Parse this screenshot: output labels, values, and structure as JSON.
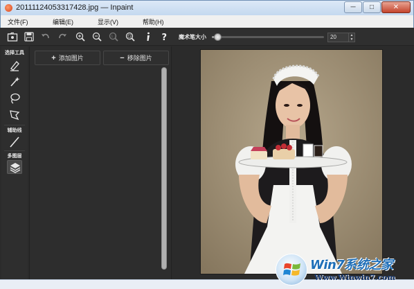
{
  "window": {
    "title": "20111124053317428.jpg — Inpaint",
    "buttons": {
      "minimize": "─",
      "maximize": "□",
      "close": "✕"
    }
  },
  "menu": [
    {
      "label": "文件(F)"
    },
    {
      "label": "编辑(E)"
    },
    {
      "label": "显示(V)"
    },
    {
      "label": "帮助(H)"
    }
  ],
  "toolbar": {
    "icons": [
      "open-icon",
      "save-icon",
      "undo-icon",
      "redo-icon",
      "zoom-in-icon",
      "zoom-out-icon",
      "actual-size-icon",
      "fit-window-icon",
      "info-icon",
      "help-icon"
    ],
    "brush_size_label": "魔术笔大小",
    "brush_size_value": "20",
    "brush_size_fraction": 0.05
  },
  "tools": {
    "select_label": "选择工具",
    "select_items": [
      "marker-icon",
      "magic-wand-icon",
      "lasso-icon",
      "polygonal-lasso-icon"
    ],
    "guide_label": "辅助线",
    "guide_items": [
      "line-icon"
    ],
    "multi_label": "多图层",
    "multi_items": [
      "layers-icon"
    ]
  },
  "image_panel": {
    "add_label": "添加图片",
    "add_symbol": "+",
    "remove_label": "移除图片",
    "remove_symbol": "−"
  },
  "watermark": {
    "brand": "Win7系统之家",
    "url": "Www.Winwin7.com"
  },
  "colors": {
    "background": "#2b2b2b",
    "panel": "#2d2d2d",
    "title_bar": "#c4d8ef",
    "close_button": "#c4442c"
  }
}
